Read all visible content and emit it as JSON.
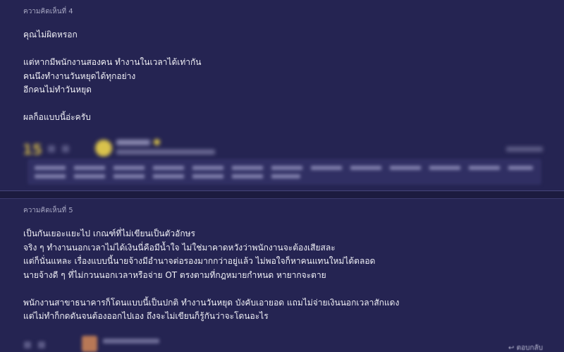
{
  "comments": [
    {
      "label": "ความคิดเห็นที่ 4",
      "lines": [
        "คุณไม่ผิดหรอก",
        "",
        "แต่หากมีพนักงานสองคน ทำงานในเวลาได้เท่ากัน",
        "คนนึงทำงานวันหยุดได้ทุกอย่าง",
        "อีกคนไม่ทำวันหยุด",
        "",
        "ผลก็อแบบนี้อ่ะครับ"
      ]
    },
    {
      "label": "ความคิดเห็นที่ 5",
      "lines": [
        "เป็นกันเยอะแยะไป เกณฑ์ที่ไม่เขียนเป็นตัวอักษร",
        "จริง ๆ ทำงานนอกเวลาไม่ได้เงินนี่คือมีน้ำใจ ไม่ใช่มาคาดหวังว่าพนักงานจะต้องเสียสละ",
        "แต่ก็นั่นแหละ เรื่องแบบนี้นายจ้างมีอำนาจต่อรองมากกว่าอยู่แล้ว ไม่พอใจก็หาคนแทนใหม่ได้ตลอด",
        "นายจ้างดี ๆ ที่ไม่กวนนอกเวลาหรือจ่าย OT ตรงตามที่กฎหมายกำหนด หายากจะตาย",
        "",
        "พนักงานสาขาธนาคารก็โดนแบบนี้เป็นปกติ ทำงานวันหยุด บังคับเอายอด แถมไม่จ่ายเงินนอกเวลาสักแดง",
        "แต่ไม่ทำก็กดดันจนต้องออกไปเอง ถึงจะไม่เขียนก็รู้กันว่าจะโดนอะไร"
      ]
    }
  ],
  "footer4": {
    "score": "15"
  },
  "footer5": {
    "reply_label": "ตอบกลับ"
  },
  "colors": {
    "background": "#1f1e44",
    "panel": "#252452",
    "text": "#f0f0f6",
    "muted": "#a7a7c2"
  }
}
